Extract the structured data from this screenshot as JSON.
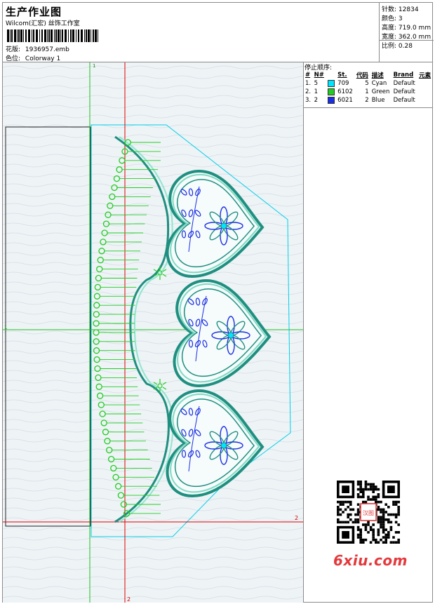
{
  "header": {
    "title": "生产作业图",
    "subtitle": "Wilcom(汇宏) 丝饰工作室",
    "design_label": "花版:",
    "design_file": "1936957.emb",
    "colorway_label": "色位:",
    "colorway": "Colorway 1"
  },
  "stats": {
    "stitches_label": "针数:",
    "stitches": "12834",
    "colors_label": "颜色:",
    "colors": "3",
    "height_label": "高度:",
    "height": "719.0 mm",
    "width_label": "宽度:",
    "width": "362.0 mm",
    "scale_label": "比例:",
    "scale": "0.28"
  },
  "stop_sequence": {
    "caption": "停止顺序:",
    "columns": [
      "#",
      "N#",
      "St.",
      "代码",
      "描述",
      "Brand",
      "元素"
    ],
    "rows": [
      {
        "idx": "1.",
        "n": "5",
        "swatch": "#00e5ff",
        "st": "709",
        "code": "5",
        "desc": "Cyan",
        "brand": "Default"
      },
      {
        "idx": "2.",
        "n": "1",
        "swatch": "#22cc22",
        "st": "6102",
        "code": "1",
        "desc": "Green",
        "brand": "Default"
      },
      {
        "idx": "3.",
        "n": "2",
        "swatch": "#1a2ee6",
        "st": "6021",
        "code": "2",
        "desc": "Blue",
        "brand": "Default"
      }
    ]
  },
  "canvas": {
    "axis_labels": [
      "1",
      "1",
      "2",
      "2"
    ]
  },
  "watermark": {
    "brand": "6xiu.com",
    "stamp": "汉图"
  },
  "colors": {
    "cyan": "#00e5ff",
    "green": "#22cc22",
    "blue": "#1a2ee6",
    "teal": "#1f8f80",
    "red": "#e00000",
    "canvas_bg": "#eef3f6"
  }
}
